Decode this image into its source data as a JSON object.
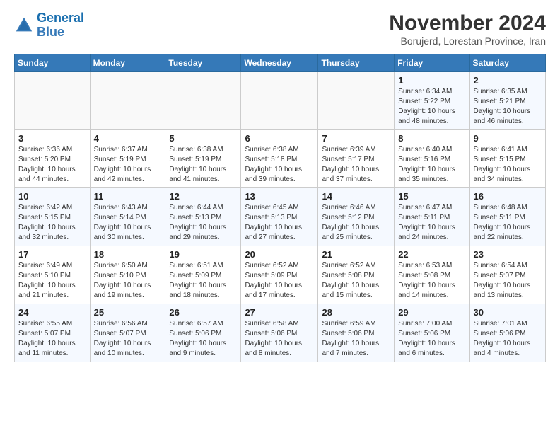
{
  "header": {
    "logo_line1": "General",
    "logo_line2": "Blue",
    "month": "November 2024",
    "location": "Borujerd, Lorestan Province, Iran"
  },
  "weekdays": [
    "Sunday",
    "Monday",
    "Tuesday",
    "Wednesday",
    "Thursday",
    "Friday",
    "Saturday"
  ],
  "weeks": [
    [
      {
        "day": "",
        "info": ""
      },
      {
        "day": "",
        "info": ""
      },
      {
        "day": "",
        "info": ""
      },
      {
        "day": "",
        "info": ""
      },
      {
        "day": "",
        "info": ""
      },
      {
        "day": "1",
        "info": "Sunrise: 6:34 AM\nSunset: 5:22 PM\nDaylight: 10 hours\nand 48 minutes."
      },
      {
        "day": "2",
        "info": "Sunrise: 6:35 AM\nSunset: 5:21 PM\nDaylight: 10 hours\nand 46 minutes."
      }
    ],
    [
      {
        "day": "3",
        "info": "Sunrise: 6:36 AM\nSunset: 5:20 PM\nDaylight: 10 hours\nand 44 minutes."
      },
      {
        "day": "4",
        "info": "Sunrise: 6:37 AM\nSunset: 5:19 PM\nDaylight: 10 hours\nand 42 minutes."
      },
      {
        "day": "5",
        "info": "Sunrise: 6:38 AM\nSunset: 5:19 PM\nDaylight: 10 hours\nand 41 minutes."
      },
      {
        "day": "6",
        "info": "Sunrise: 6:38 AM\nSunset: 5:18 PM\nDaylight: 10 hours\nand 39 minutes."
      },
      {
        "day": "7",
        "info": "Sunrise: 6:39 AM\nSunset: 5:17 PM\nDaylight: 10 hours\nand 37 minutes."
      },
      {
        "day": "8",
        "info": "Sunrise: 6:40 AM\nSunset: 5:16 PM\nDaylight: 10 hours\nand 35 minutes."
      },
      {
        "day": "9",
        "info": "Sunrise: 6:41 AM\nSunset: 5:15 PM\nDaylight: 10 hours\nand 34 minutes."
      }
    ],
    [
      {
        "day": "10",
        "info": "Sunrise: 6:42 AM\nSunset: 5:15 PM\nDaylight: 10 hours\nand 32 minutes."
      },
      {
        "day": "11",
        "info": "Sunrise: 6:43 AM\nSunset: 5:14 PM\nDaylight: 10 hours\nand 30 minutes."
      },
      {
        "day": "12",
        "info": "Sunrise: 6:44 AM\nSunset: 5:13 PM\nDaylight: 10 hours\nand 29 minutes."
      },
      {
        "day": "13",
        "info": "Sunrise: 6:45 AM\nSunset: 5:13 PM\nDaylight: 10 hours\nand 27 minutes."
      },
      {
        "day": "14",
        "info": "Sunrise: 6:46 AM\nSunset: 5:12 PM\nDaylight: 10 hours\nand 25 minutes."
      },
      {
        "day": "15",
        "info": "Sunrise: 6:47 AM\nSunset: 5:11 PM\nDaylight: 10 hours\nand 24 minutes."
      },
      {
        "day": "16",
        "info": "Sunrise: 6:48 AM\nSunset: 5:11 PM\nDaylight: 10 hours\nand 22 minutes."
      }
    ],
    [
      {
        "day": "17",
        "info": "Sunrise: 6:49 AM\nSunset: 5:10 PM\nDaylight: 10 hours\nand 21 minutes."
      },
      {
        "day": "18",
        "info": "Sunrise: 6:50 AM\nSunset: 5:10 PM\nDaylight: 10 hours\nand 19 minutes."
      },
      {
        "day": "19",
        "info": "Sunrise: 6:51 AM\nSunset: 5:09 PM\nDaylight: 10 hours\nand 18 minutes."
      },
      {
        "day": "20",
        "info": "Sunrise: 6:52 AM\nSunset: 5:09 PM\nDaylight: 10 hours\nand 17 minutes."
      },
      {
        "day": "21",
        "info": "Sunrise: 6:52 AM\nSunset: 5:08 PM\nDaylight: 10 hours\nand 15 minutes."
      },
      {
        "day": "22",
        "info": "Sunrise: 6:53 AM\nSunset: 5:08 PM\nDaylight: 10 hours\nand 14 minutes."
      },
      {
        "day": "23",
        "info": "Sunrise: 6:54 AM\nSunset: 5:07 PM\nDaylight: 10 hours\nand 13 minutes."
      }
    ],
    [
      {
        "day": "24",
        "info": "Sunrise: 6:55 AM\nSunset: 5:07 PM\nDaylight: 10 hours\nand 11 minutes."
      },
      {
        "day": "25",
        "info": "Sunrise: 6:56 AM\nSunset: 5:07 PM\nDaylight: 10 hours\nand 10 minutes."
      },
      {
        "day": "26",
        "info": "Sunrise: 6:57 AM\nSunset: 5:06 PM\nDaylight: 10 hours\nand 9 minutes."
      },
      {
        "day": "27",
        "info": "Sunrise: 6:58 AM\nSunset: 5:06 PM\nDaylight: 10 hours\nand 8 minutes."
      },
      {
        "day": "28",
        "info": "Sunrise: 6:59 AM\nSunset: 5:06 PM\nDaylight: 10 hours\nand 7 minutes."
      },
      {
        "day": "29",
        "info": "Sunrise: 7:00 AM\nSunset: 5:06 PM\nDaylight: 10 hours\nand 6 minutes."
      },
      {
        "day": "30",
        "info": "Sunrise: 7:01 AM\nSunset: 5:06 PM\nDaylight: 10 hours\nand 4 minutes."
      }
    ]
  ]
}
